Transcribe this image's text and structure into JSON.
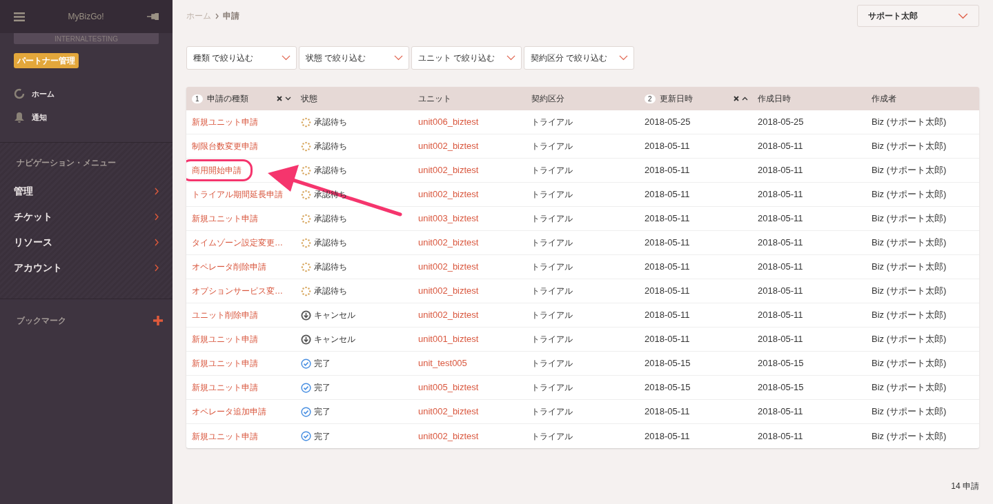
{
  "sidebar": {
    "app_title": "MyBizGo!",
    "environment": "INTERNALTESTING",
    "role_badge": "パートナー管理",
    "top_items": [
      {
        "label": "ホーム",
        "kind": "home"
      },
      {
        "label": "通知",
        "kind": "bell"
      }
    ],
    "nav_heading": "ナビゲーション・メニュー",
    "nav_items": [
      {
        "label": "管理"
      },
      {
        "label": "チケット"
      },
      {
        "label": "リソース"
      },
      {
        "label": "アカウント"
      }
    ],
    "bookmarks_heading": "ブックマーク"
  },
  "breadcrumb": [
    {
      "label": "ホーム",
      "current": false
    },
    {
      "label": "申請",
      "current": true
    }
  ],
  "user_menu": {
    "label": "サポート太郎"
  },
  "filters": [
    {
      "label": "種類 で絞り込む"
    },
    {
      "label": "状態 で絞り込む"
    },
    {
      "label": "ユニット で絞り込む"
    },
    {
      "label": "契約区分 で絞り込む"
    }
  ],
  "table": {
    "columns": [
      {
        "label": "申請の種類",
        "sort_order": "1",
        "sorted": true,
        "ascending": false
      },
      {
        "label": "状態",
        "sorted": false
      },
      {
        "label": "ユニット",
        "sorted": false
      },
      {
        "label": "契約区分",
        "sorted": false
      },
      {
        "label": "更新日時",
        "sort_order": "2",
        "sorted": true,
        "ascending": true
      },
      {
        "label": "作成日時",
        "sorted": false
      },
      {
        "label": "作成者",
        "sorted": false
      }
    ],
    "rows": [
      {
        "type": "新規ユニット申請",
        "status": {
          "label": "承認待ち",
          "kind": "pending"
        },
        "unit": "unit006_biztest",
        "contract": "トライアル",
        "updated": "2018-05-25",
        "created": "2018-05-25",
        "creator": "Biz (サポート太郎)",
        "highlighted": false
      },
      {
        "type": "制限台数変更申請",
        "status": {
          "label": "承認待ち",
          "kind": "pending"
        },
        "unit": "unit002_biztest",
        "contract": "トライアル",
        "updated": "2018-05-11",
        "created": "2018-05-11",
        "creator": "Biz (サポート太郎)",
        "highlighted": false
      },
      {
        "type": "商用開始申請",
        "status": {
          "label": "承認待ち",
          "kind": "pending"
        },
        "unit": "unit002_biztest",
        "contract": "トライアル",
        "updated": "2018-05-11",
        "created": "2018-05-11",
        "creator": "Biz (サポート太郎)",
        "highlighted": true
      },
      {
        "type": "トライアル期間延長申請",
        "status": {
          "label": "承認待ち",
          "kind": "pending"
        },
        "unit": "unit002_biztest",
        "contract": "トライアル",
        "updated": "2018-05-11",
        "created": "2018-05-11",
        "creator": "Biz (サポート太郎)",
        "highlighted": false
      },
      {
        "type": "新規ユニット申請",
        "status": {
          "label": "承認待ち",
          "kind": "pending"
        },
        "unit": "unit003_biztest",
        "contract": "トライアル",
        "updated": "2018-05-11",
        "created": "2018-05-11",
        "creator": "Biz (サポート太郎)",
        "highlighted": false
      },
      {
        "type": "タイムゾーン設定変更…",
        "status": {
          "label": "承認待ち",
          "kind": "pending"
        },
        "unit": "unit002_biztest",
        "contract": "トライアル",
        "updated": "2018-05-11",
        "created": "2018-05-11",
        "creator": "Biz (サポート太郎)",
        "highlighted": false
      },
      {
        "type": "オペレータ削除申請",
        "status": {
          "label": "承認待ち",
          "kind": "pending"
        },
        "unit": "unit002_biztest",
        "contract": "トライアル",
        "updated": "2018-05-11",
        "created": "2018-05-11",
        "creator": "Biz (サポート太郎)",
        "highlighted": false
      },
      {
        "type": "オプションサービス変…",
        "status": {
          "label": "承認待ち",
          "kind": "pending"
        },
        "unit": "unit002_biztest",
        "contract": "トライアル",
        "updated": "2018-05-11",
        "created": "2018-05-11",
        "creator": "Biz (サポート太郎)",
        "highlighted": false
      },
      {
        "type": "ユニット削除申請",
        "status": {
          "label": "キャンセル",
          "kind": "cancelled"
        },
        "unit": "unit002_biztest",
        "contract": "トライアル",
        "updated": "2018-05-11",
        "created": "2018-05-11",
        "creator": "Biz (サポート太郎)",
        "highlighted": false
      },
      {
        "type": "新規ユニット申請",
        "status": {
          "label": "キャンセル",
          "kind": "cancelled"
        },
        "unit": "unit001_biztest",
        "contract": "トライアル",
        "updated": "2018-05-11",
        "created": "2018-05-11",
        "creator": "Biz (サポート太郎)",
        "highlighted": false
      },
      {
        "type": "新規ユニット申請",
        "status": {
          "label": "完了",
          "kind": "done"
        },
        "unit": "unit_test005",
        "contract": "トライアル",
        "updated": "2018-05-15",
        "created": "2018-05-15",
        "creator": "Biz (サポート太郎)",
        "highlighted": false
      },
      {
        "type": "新規ユニット申請",
        "status": {
          "label": "完了",
          "kind": "done"
        },
        "unit": "unit005_biztest",
        "contract": "トライアル",
        "updated": "2018-05-15",
        "created": "2018-05-15",
        "creator": "Biz (サポート太郎)",
        "highlighted": false
      },
      {
        "type": "オペレータ追加申請",
        "status": {
          "label": "完了",
          "kind": "done"
        },
        "unit": "unit002_biztest",
        "contract": "トライアル",
        "updated": "2018-05-11",
        "created": "2018-05-11",
        "creator": "Biz (サポート太郎)",
        "highlighted": false
      },
      {
        "type": "新規ユニット申請",
        "status": {
          "label": "完了",
          "kind": "done"
        },
        "unit": "unit002_biztest",
        "contract": "トライアル",
        "updated": "2018-05-11",
        "created": "2018-05-11",
        "creator": "Biz (サポート太郎)",
        "highlighted": false
      }
    ]
  },
  "footer": {
    "count": "14 申請"
  }
}
